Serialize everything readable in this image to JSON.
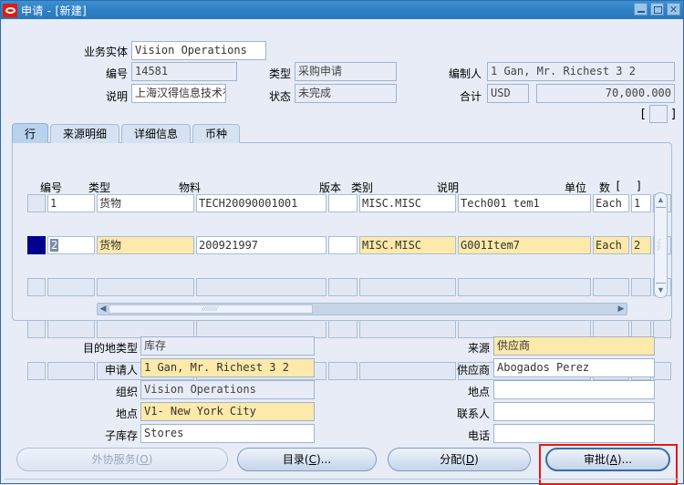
{
  "window": {
    "title": "申请 - [新建]",
    "logo_icon": "oracle-logo-icon",
    "minimize_label": "",
    "maximize_label": "",
    "close_label": "✕"
  },
  "header": {
    "fields": [
      {
        "label": "业务实体",
        "value": "Vision Operations",
        "state": "editable"
      },
      {
        "label": "编号",
        "value": "14581",
        "state": "readonly"
      },
      {
        "label": "说明",
        "value": "上海汉得信息技术有",
        "state": "editable"
      },
      {
        "label": "类型",
        "value": "采购申请",
        "state": "readonly"
      },
      {
        "label": "状态",
        "value": "未完成",
        "state": "readonly"
      },
      {
        "label": "编制人",
        "value": "1 Gan, Mr. Richest 3 2",
        "state": "readonly"
      },
      {
        "label": "合计",
        "value": "USD",
        "state": "readonly"
      },
      {
        "label": "",
        "value": "70,000.000",
        "state": "readonly"
      }
    ],
    "bracket_left": "[",
    "bracket_right": "]"
  },
  "tabs": [
    {
      "label": "行",
      "active": true
    },
    {
      "label": "来源明细",
      "active": false
    },
    {
      "label": "详细信息",
      "active": false
    },
    {
      "label": "币种",
      "active": false
    }
  ],
  "grid": {
    "columns": [
      "编号",
      "类型",
      "物料",
      "版本",
      "类别",
      "说明",
      "单位",
      "数",
      "[",
      "]"
    ],
    "rows": [
      {
        "selected": false,
        "highlight": false,
        "num": "1",
        "type": "货物",
        "item": "TECH20090001001",
        "rev": "",
        "category": "MISC.MISC",
        "description": "Tech001    tem1",
        "uom": "Each",
        "qty": "1",
        "extra": ""
      },
      {
        "selected": true,
        "highlight": true,
        "num": "2",
        "type": "货物",
        "item": "200921997",
        "rev": "",
        "category": "MISC.MISC",
        "description": "G001Item7",
        "uom": "Each",
        "qty": "2",
        "extra": ""
      },
      {
        "selected": false,
        "highlight": false,
        "num": "",
        "type": "",
        "item": "",
        "rev": "",
        "category": "",
        "description": "",
        "uom": "",
        "qty": "",
        "extra": ""
      },
      {
        "selected": false,
        "highlight": false,
        "num": "",
        "type": "",
        "item": "",
        "rev": "",
        "category": "",
        "description": "",
        "uom": "",
        "qty": "",
        "extra": ""
      },
      {
        "selected": false,
        "highlight": false,
        "num": "",
        "type": "",
        "item": "",
        "rev": "",
        "category": "",
        "description": "",
        "uom": "",
        "qty": "",
        "extra": ""
      }
    ],
    "vscroll_up_icon": "▲",
    "vscroll_down_icon": "▼",
    "hscroll_left_icon": "◀",
    "hscroll_right_icon": "▶"
  },
  "details": {
    "left": [
      {
        "label": "目的地类型",
        "value": "库存",
        "state": "readonly"
      },
      {
        "label": "申请人",
        "value": "1 Gan, Mr. Richest 3 2",
        "state": "highlight"
      },
      {
        "label": "组织",
        "value": "Vision Operations",
        "state": "readonly"
      },
      {
        "label": "地点",
        "value": "V1- New York City",
        "state": "highlight"
      },
      {
        "label": "子库存",
        "value": "Stores",
        "state": "editable"
      }
    ],
    "right": [
      {
        "label": "来源",
        "value": "供应商",
        "state": "highlight"
      },
      {
        "label": "供应商",
        "value": "Abogados Perez",
        "state": "editable"
      },
      {
        "label": "地点",
        "value": "",
        "state": "editable"
      },
      {
        "label": "联系人",
        "value": "",
        "state": "editable"
      },
      {
        "label": "电话",
        "value": "",
        "state": "editable"
      }
    ]
  },
  "buttons": [
    {
      "label": "外协服务(O)",
      "hotkey": "O",
      "text_before": "外协服务(",
      "text_after": ")",
      "disabled": true,
      "focused": false
    },
    {
      "label": "目录(C)...",
      "hotkey": "C",
      "text_before": "目录(",
      "text_after": ")...",
      "disabled": false,
      "focused": false
    },
    {
      "label": "分配(D)",
      "hotkey": "D",
      "text_before": "分配(",
      "text_after": ")",
      "disabled": false,
      "focused": false
    },
    {
      "label": "审批(A)...",
      "hotkey": "A",
      "text_before": "审批(",
      "text_after": ")...",
      "disabled": false,
      "focused": true
    }
  ],
  "colors": {
    "titlebar": "#2f80c5",
    "background": "#e7ecf6",
    "highlight_field": "#fde9a9",
    "selection_marker": "#00008f",
    "focus_outline": "#e8180c",
    "tab_active": "#b9d2ee"
  }
}
